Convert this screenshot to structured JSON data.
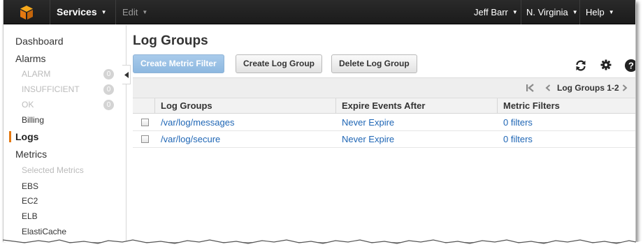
{
  "topnav": {
    "services_label": "Services",
    "edit_label": "Edit",
    "user_label": "Jeff Barr",
    "region_label": "N. Virginia",
    "help_label": "Help"
  },
  "sidebar": {
    "dashboard": "Dashboard",
    "alarms": "Alarms",
    "alarm_states": [
      {
        "label": "ALARM",
        "count": "0"
      },
      {
        "label": "INSUFFICIENT",
        "count": "0"
      },
      {
        "label": "OK",
        "count": "0"
      }
    ],
    "billing": "Billing",
    "logs": "Logs",
    "metrics": "Metrics",
    "selected_metrics": "Selected Metrics",
    "namespaces": [
      "EBS",
      "EC2",
      "ELB",
      "ElastiCache"
    ]
  },
  "main": {
    "title": "Log Groups",
    "buttons": {
      "create_metric_filter": "Create Metric Filter",
      "create_log_group": "Create Log Group",
      "delete_log_group": "Delete Log Group"
    },
    "pager_label": "Log Groups 1-2",
    "columns": [
      "Log Groups",
      "Expire Events After",
      "Metric Filters"
    ],
    "rows": [
      {
        "name": "/var/log/messages",
        "expire": "Never Expire",
        "filters": "0 filters"
      },
      {
        "name": "/var/log/secure",
        "expire": "Never Expire",
        "filters": "0 filters"
      }
    ]
  },
  "colors": {
    "nav_bg": "#1f1f1f",
    "accent_orange": "#e47911",
    "link_blue": "#1f66b5",
    "primary_button": "#9fc3e6"
  }
}
